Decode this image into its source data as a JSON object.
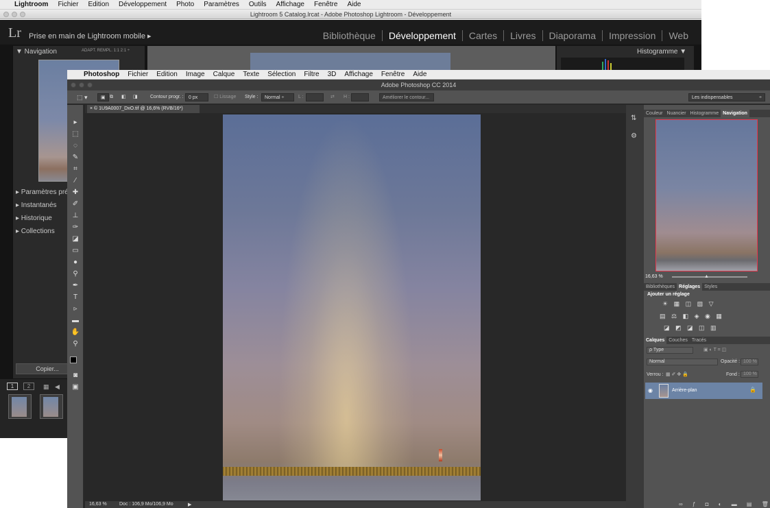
{
  "lightroom": {
    "menubar": {
      "apple": "",
      "app": "Lightroom",
      "items": [
        "Fichier",
        "Edition",
        "Développement",
        "Photo",
        "Paramètres",
        "Outils",
        "Affichage",
        "Fenêtre",
        "Aide"
      ]
    },
    "title": "Lightroom 5 Catalog.lrcat - Adobe Photoshop Lightroom - Développement",
    "logo": "Lr",
    "mobile": "Prise en main de Lightroom mobile ▸",
    "modules": [
      "Bibliothèque",
      "Développement",
      "Cartes",
      "Livres",
      "Diaporama",
      "Impression",
      "Web"
    ],
    "active_module": "Développement",
    "navigator": {
      "title": "▼ Navigation",
      "zoom_opts": "ADAPT.  REMPL.  1:1  2:1 ÷"
    },
    "sections": [
      "▸ Paramètres pré",
      "▸ Instantanés",
      "▸ Historique",
      "▸ Collections"
    ],
    "copy_button": "Copier...",
    "histogram_title": "Histogramme ▼",
    "filmstrip": {
      "page1": "1",
      "page2": "2"
    }
  },
  "photoshop": {
    "menubar": {
      "apple": "",
      "app": "Photoshop",
      "items": [
        "Fichier",
        "Edition",
        "Image",
        "Calque",
        "Texte",
        "Sélection",
        "Filtre",
        "3D",
        "Affichage",
        "Fenêtre",
        "Aide"
      ]
    },
    "title": "Adobe Photoshop CC 2014",
    "options": {
      "feather_label": "Contour progr. :",
      "feather_value": "0 px",
      "antialias_label": "Lissage",
      "style_label": "Style :",
      "style_value": "Normal",
      "w_label": "L :",
      "h_label": "H :",
      "refine_button": "Améliorer le contour...",
      "workspace": "Les indispensables"
    },
    "doc_tab": "× © 1U9A0007_DxO.tif @ 16,6% (RVB/16*)",
    "status": {
      "zoom": "16,63 %",
      "doc": "Doc : 106,9 Mo/106,9 Mo",
      "arrow": "▶"
    },
    "panel_tabs_top": [
      "Couleur",
      "Nuancier",
      "Histogramme",
      "Navigation"
    ],
    "panel_tabs_top_active": "Navigation",
    "nav_zoom": "16,63 %",
    "panel_tabs_mid": [
      "Bibliothèques",
      "Réglages",
      "Styles"
    ],
    "panel_tabs_mid_active": "Réglages",
    "adjust_title": "Ajouter un réglage",
    "adjust_rows": [
      "☀ ▦ ◫ ▧ ▽",
      "▤ ⚖ ◧ ◈ ◉ ▦",
      "◪ ◩ ◪ ◫ ▥"
    ],
    "panel_tabs_layers": [
      "Calques",
      "Couches",
      "Tracés"
    ],
    "panel_tabs_layers_active": "Calques",
    "layers": {
      "filter": "ρ Type",
      "blend": "Normal",
      "opacity_label": "Opacité :",
      "opacity_value": "100 %",
      "lock_label": "Verrou :",
      "fill_label": "Fond :",
      "fill_value": "100 %",
      "layer_name": "Arrière-plan"
    }
  }
}
